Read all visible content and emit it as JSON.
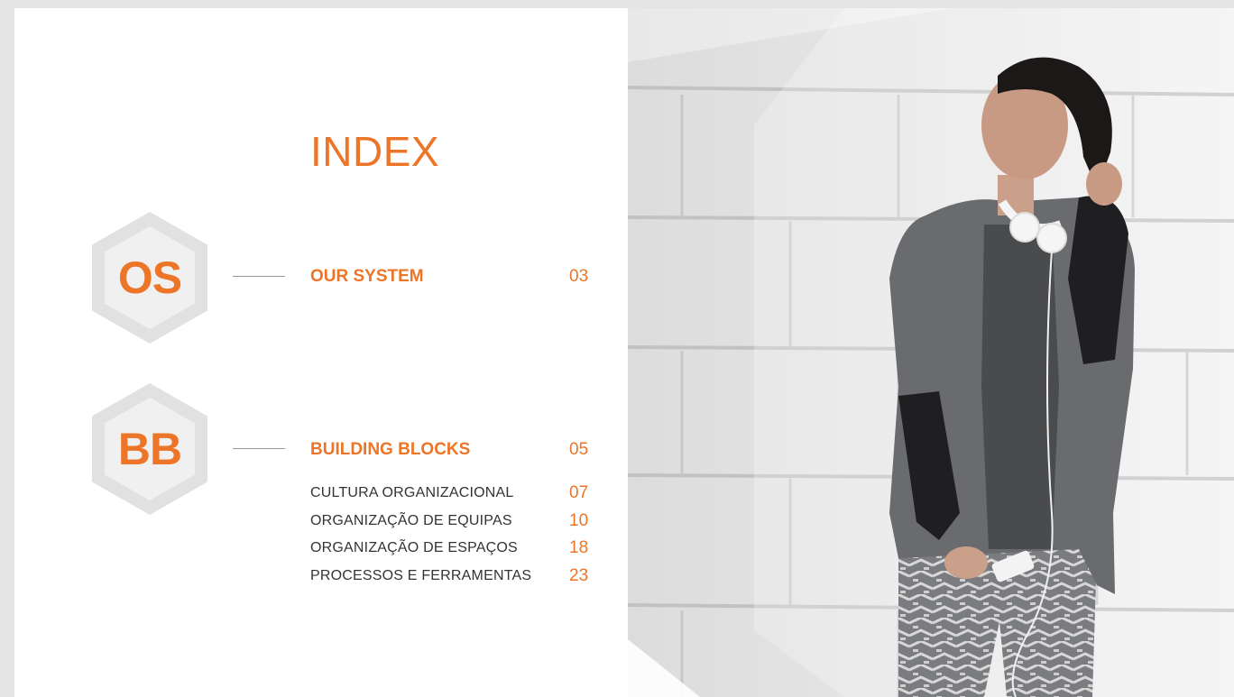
{
  "index": {
    "title": "INDEX",
    "sections": [
      {
        "badge": "OS",
        "label": "OUR SYSTEM",
        "page": "03",
        "subitems": []
      },
      {
        "badge": "BB",
        "label": "BUILDING BLOCKS",
        "page": "05",
        "subitems": [
          {
            "label": "CULTURA ORGANIZACIONAL",
            "page": "07"
          },
          {
            "label": "ORGANIZAÇÃO DE EQUIPAS",
            "page": "10"
          },
          {
            "label": "ORGANIZAÇÃO DE ESPAÇOS",
            "page": "18"
          },
          {
            "label": "PROCESSOS E FERRAMENTAS",
            "page": "23"
          }
        ]
      }
    ]
  },
  "colors": {
    "accent": "#ec7527",
    "hex_outer": "#e1e1e1",
    "hex_inner": "#f0f0f0"
  },
  "photo": {
    "icon": "woman-with-headphones-photo"
  }
}
